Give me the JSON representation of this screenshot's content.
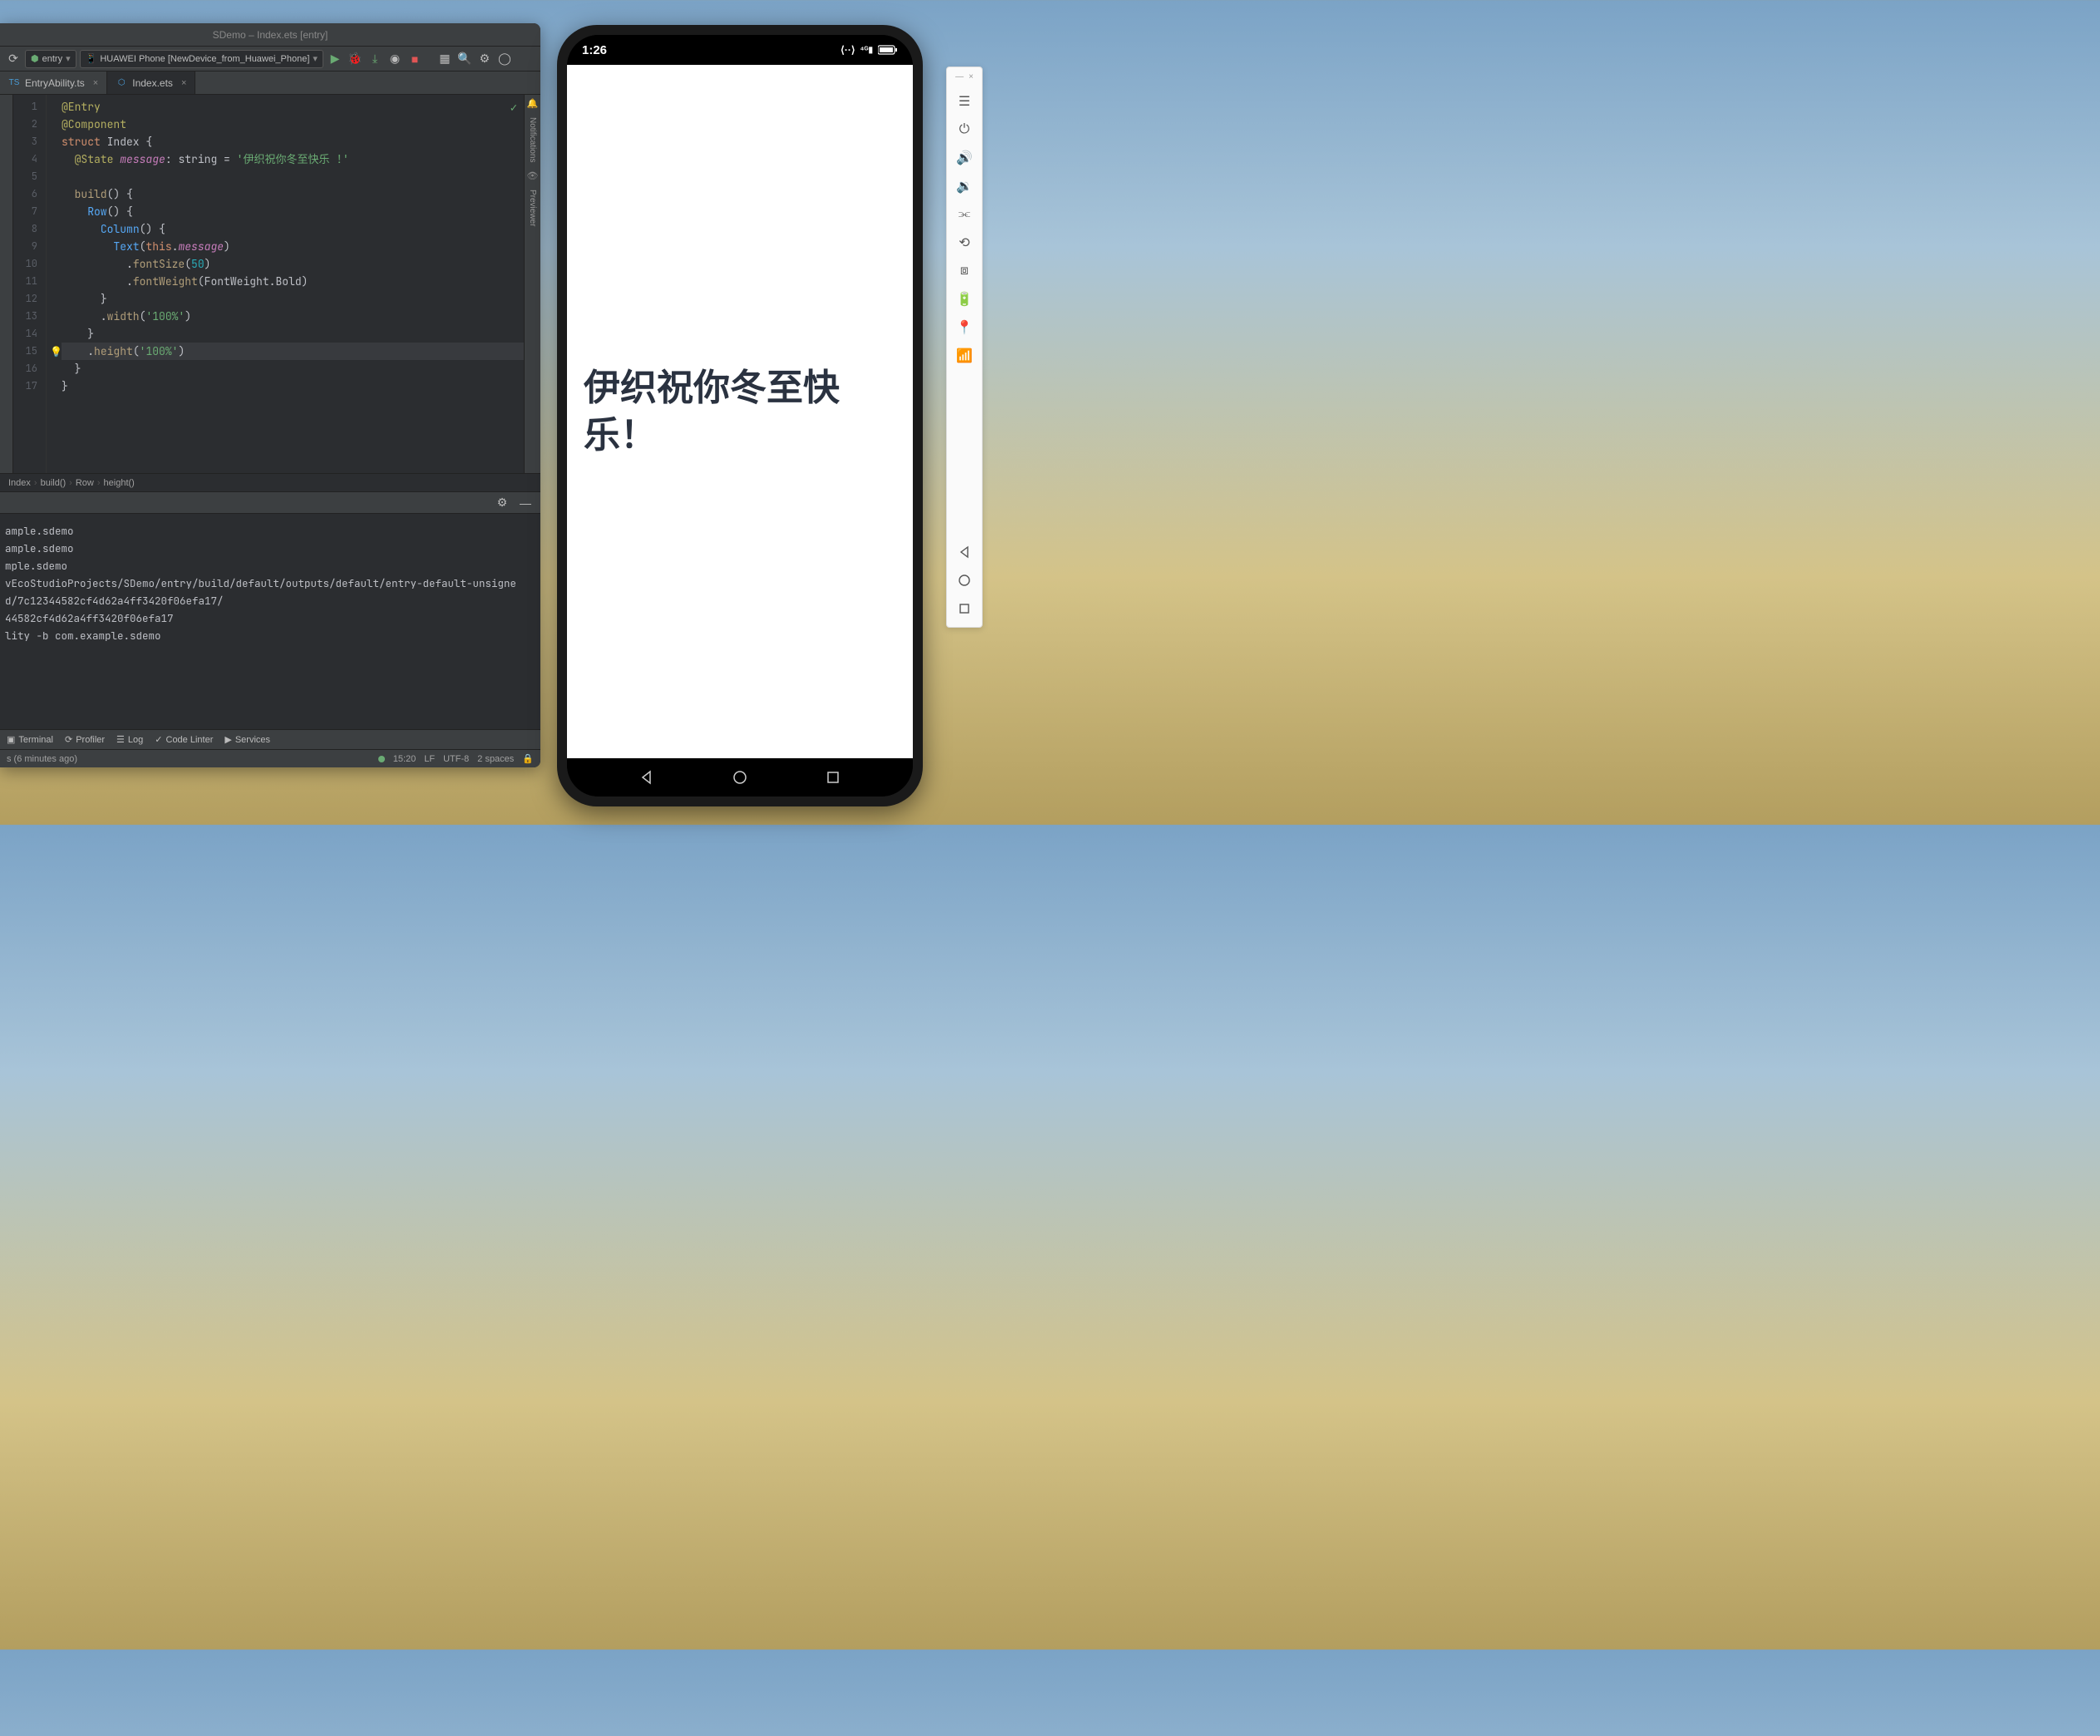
{
  "window": {
    "title": "SDemo – Index.ets [entry]"
  },
  "toolbar": {
    "run_config": "entry",
    "device": "HUAWEI Phone [NewDevice_from_Huawei_Phone]"
  },
  "tabs": [
    {
      "name": "EntryAbility.ts",
      "active": false
    },
    {
      "name": "Index.ets",
      "active": true
    }
  ],
  "code": {
    "lines": 17,
    "tokens": [
      [
        [
          "decorator",
          "@Entry"
        ]
      ],
      [
        [
          "decorator",
          "@Component"
        ]
      ],
      [
        [
          "kw",
          "struct "
        ],
        [
          "type",
          "Index "
        ],
        [
          "punct",
          "{"
        ]
      ],
      [
        [
          "punct",
          "  "
        ],
        [
          "decorator",
          "@State "
        ],
        [
          "prop",
          "message"
        ],
        [
          "punct",
          ": "
        ],
        [
          "type",
          "string"
        ],
        [
          "punct",
          " = "
        ],
        [
          "str",
          "'伊织祝你冬至快乐 !'"
        ]
      ],
      [],
      [
        [
          "punct",
          "  "
        ],
        [
          "method",
          "build"
        ],
        [
          "punct",
          "() "
        ],
        [
          "punct",
          "{"
        ]
      ],
      [
        [
          "punct",
          "    "
        ],
        [
          "fn",
          "Row"
        ],
        [
          "punct",
          "() "
        ],
        [
          "punct",
          "{"
        ]
      ],
      [
        [
          "punct",
          "      "
        ],
        [
          "fn",
          "Column"
        ],
        [
          "punct",
          "() "
        ],
        [
          "punct",
          "{"
        ]
      ],
      [
        [
          "punct",
          "        "
        ],
        [
          "fn",
          "Text"
        ],
        [
          "punct",
          "("
        ],
        [
          "kw",
          "this"
        ],
        [
          "punct",
          "."
        ],
        [
          "prop",
          "message"
        ],
        [
          "punct",
          ")"
        ]
      ],
      [
        [
          "punct",
          "          ."
        ],
        [
          "method",
          "fontSize"
        ],
        [
          "punct",
          "("
        ],
        [
          "num",
          "50"
        ],
        [
          "punct",
          ")"
        ]
      ],
      [
        [
          "punct",
          "          ."
        ],
        [
          "method",
          "fontWeight"
        ],
        [
          "punct",
          "("
        ],
        [
          "type",
          "FontWeight"
        ],
        [
          "punct",
          "."
        ],
        [
          "ident",
          "Bold"
        ],
        [
          "punct",
          ")"
        ]
      ],
      [
        [
          "punct",
          "      "
        ],
        [
          "punct",
          "}"
        ]
      ],
      [
        [
          "punct",
          "      ."
        ],
        [
          "method",
          "width"
        ],
        [
          "punct",
          "("
        ],
        [
          "str",
          "'100%'"
        ],
        [
          "punct",
          ")"
        ]
      ],
      [
        [
          "punct",
          "    "
        ],
        [
          "punct",
          "}"
        ]
      ],
      [
        [
          "punct",
          "    ."
        ],
        [
          "method",
          "height"
        ],
        [
          "punct",
          "("
        ],
        [
          "str",
          "'100%'"
        ],
        [
          "punct",
          ")"
        ]
      ],
      [
        [
          "punct",
          "  "
        ],
        [
          "punct",
          "}"
        ]
      ],
      [
        [
          "punct",
          "}"
        ]
      ]
    ],
    "highlight_line": 15,
    "bulb_line": 15
  },
  "breadcrumb": [
    "Index",
    "build()",
    "Row",
    "height()"
  ],
  "console": [
    "ample.sdemo",
    "ample.sdemo",
    "mple.sdemo",
    "vEcoStudioProjects/SDemo/entry/build/default/outputs/default/entry-default-unsigne",
    "d/7c12344582cf4d62a4ff3420f06efa17/",
    "44582cf4d62a4ff3420f06efa17",
    "lity -b com.example.sdemo"
  ],
  "bottom_tools": [
    "Terminal",
    "Profiler",
    "Log",
    "Code Linter",
    "Services"
  ],
  "statusbar": {
    "left": "s (6 minutes ago)",
    "pos": "15:20",
    "lf": "LF",
    "enc": "UTF-8",
    "indent": "2 spaces"
  },
  "phone": {
    "time": "1:26",
    "text": "伊织祝你冬至快乐！"
  },
  "right_tabs": [
    "Notifications",
    "Previewer"
  ]
}
